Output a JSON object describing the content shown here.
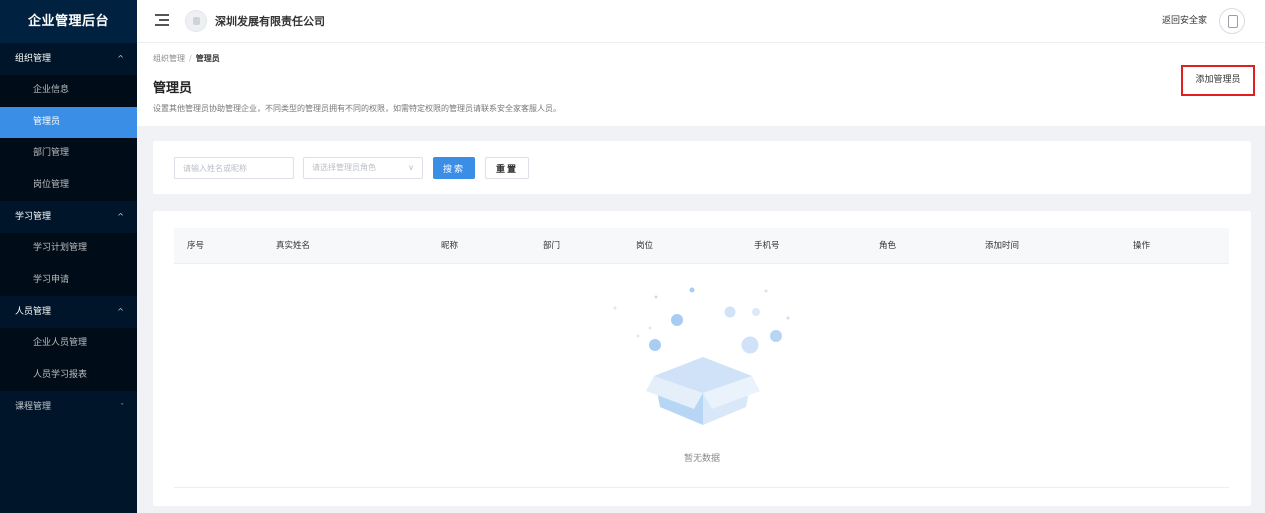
{
  "sidebar": {
    "logo": "企业管理后台",
    "groups": [
      {
        "label": "组织管理",
        "chevron": "^",
        "items": [
          "企业信息",
          "管理员",
          "部门管理",
          "岗位管理"
        ]
      },
      {
        "label": "学习管理",
        "chevron": "^",
        "items": [
          "学习计划管理",
          "学习申请"
        ]
      },
      {
        "label": "人员管理",
        "chevron": "^",
        "items": [
          "企业人员管理",
          "人员学习报表"
        ]
      },
      {
        "label": "课程管理",
        "chevron": "ˇ",
        "items": []
      }
    ],
    "active_item": "管理员"
  },
  "header": {
    "company_name": "深圳发展有限责任公司",
    "back_link": "返回安全家"
  },
  "page": {
    "breadcrumb": {
      "parent": "组织管理",
      "separator": "/",
      "current": "管理员"
    },
    "title": "管理员",
    "description": "设置其他管理员协助管理企业，不同类型的管理员拥有不同的权限，如需特定权限的管理员请联系安全家客服人员。",
    "add_button": "添加管理员"
  },
  "filter": {
    "name_placeholder": "请输入姓名或昵称",
    "role_placeholder": "请选择管理员角色",
    "role_arrow": "∨",
    "search_label": "搜索",
    "reset_label": "重置"
  },
  "table": {
    "columns": [
      "序号",
      "真实姓名",
      "昵称",
      "部门",
      "岗位",
      "手机号",
      "角色",
      "添加时间",
      "操作"
    ],
    "rows": [],
    "empty_text": "暂无数据"
  },
  "colors": {
    "sidebar_bg": "#001529",
    "accent": "#3a8ee6",
    "highlight_border": "#e02020"
  }
}
